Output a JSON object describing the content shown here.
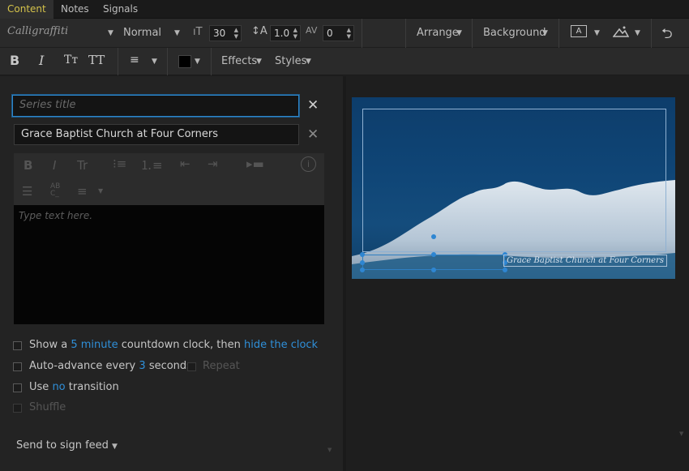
{
  "tabs": [
    {
      "label": "Content",
      "active": true
    },
    {
      "label": "Notes",
      "active": false
    },
    {
      "label": "Signals",
      "active": false
    }
  ],
  "toolbar": {
    "font_family": "Calligraffiti",
    "font_weight": "Normal",
    "font_size": "30",
    "line_height": "1.0",
    "letter_spacing": "0",
    "arrange_label": "Arrange",
    "background_label": "Background",
    "effects_label": "Effects",
    "styles_label": "Styles",
    "text_color": "#000000"
  },
  "editor": {
    "series_title_placeholder": "Series title",
    "slide_title_value": "Grace Baptist Church at Four Corners",
    "body_placeholder": "Type text here."
  },
  "options": {
    "countdown_prefix": "Show a",
    "countdown_value": "5 minute",
    "countdown_mid": "countdown clock, then",
    "countdown_action": "hide the clock",
    "advance_prefix": "Auto-advance every",
    "advance_value": "3",
    "advance_suffix": "seconds",
    "repeat_label": "Repeat",
    "transition_prefix": "Use",
    "transition_value": "no",
    "transition_suffix": "transition",
    "shuffle_label": "Shuffle",
    "send_label": "Send to sign feed"
  },
  "preview": {
    "caption": "Grace Baptist Church at Four Corners"
  },
  "colors": {
    "accent_tab": "#d4c24a",
    "link": "#2f8fd8",
    "focus": "#2e86c9"
  }
}
